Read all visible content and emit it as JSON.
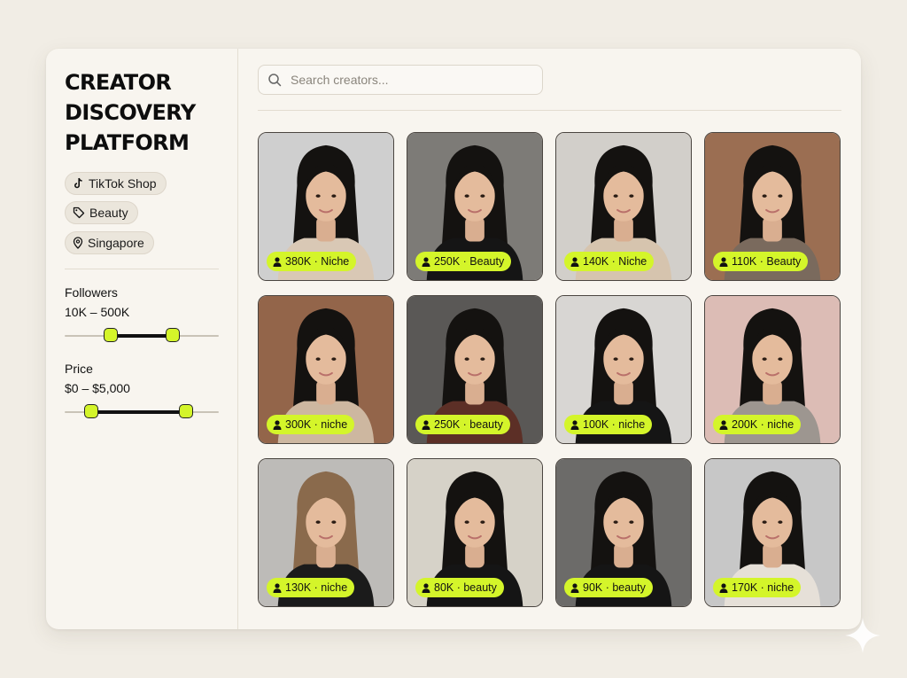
{
  "sidebar": {
    "title": "CREATOR\nDISCOVERY\nPLATFORM",
    "chips": [
      {
        "label": "TikTok Shop",
        "icon": "tiktok-icon"
      },
      {
        "label": "Beauty",
        "icon": "tag-icon"
      },
      {
        "label": "Singapore",
        "icon": "location-pin-icon"
      }
    ],
    "filters": {
      "followers": {
        "label": "Followers",
        "range": "10K – 500K",
        "low_fraction": 0.3,
        "high_fraction": 0.7
      },
      "price": {
        "label": "Price",
        "range": "$0 – $5,000",
        "low_fraction": 0.17,
        "high_fraction": 0.79
      }
    }
  },
  "search": {
    "placeholder": "Search creators...",
    "value": ""
  },
  "creators": [
    {
      "badge": "380K · Niche",
      "bg": "#cfcfcf",
      "outfit": "#d9c8b5"
    },
    {
      "badge": "250K · Beauty",
      "bg": "#7d7b77",
      "outfit": "#151515"
    },
    {
      "badge": "140K · Niche",
      "bg": "#d2cfca",
      "outfit": "#d6c4ae"
    },
    {
      "badge": "110K · Beauty",
      "bg": "#9b6e52",
      "outfit": "#7a6a5d"
    },
    {
      "badge": "300K · niche",
      "bg": "#93654a",
      "outfit": "#cdb7a0"
    },
    {
      "badge": "250K · beauty",
      "bg": "#5a5856",
      "outfit": "#5c2f26"
    },
    {
      "badge": "100K · niche",
      "bg": "#d8d6d3",
      "outfit": "#151515"
    },
    {
      "badge": "200K · niche",
      "bg": "#dcbcb5",
      "outfit": "#9d9690"
    },
    {
      "badge": "130K · niche",
      "bg": "#bdbbb8",
      "outfit": "#1b1b1b",
      "hair": "#8a6a4c"
    },
    {
      "badge": "80K · beauty",
      "bg": "#d6d2c8",
      "outfit": "#151515"
    },
    {
      "badge": "90K · beauty",
      "bg": "#6c6b69",
      "outfit": "#151515"
    },
    {
      "badge": "170K · niche",
      "bg": "#c7c7c7",
      "outfit": "#e6e0d8"
    }
  ],
  "colors": {
    "accent": "#d4f52a",
    "ink": "#111111"
  }
}
